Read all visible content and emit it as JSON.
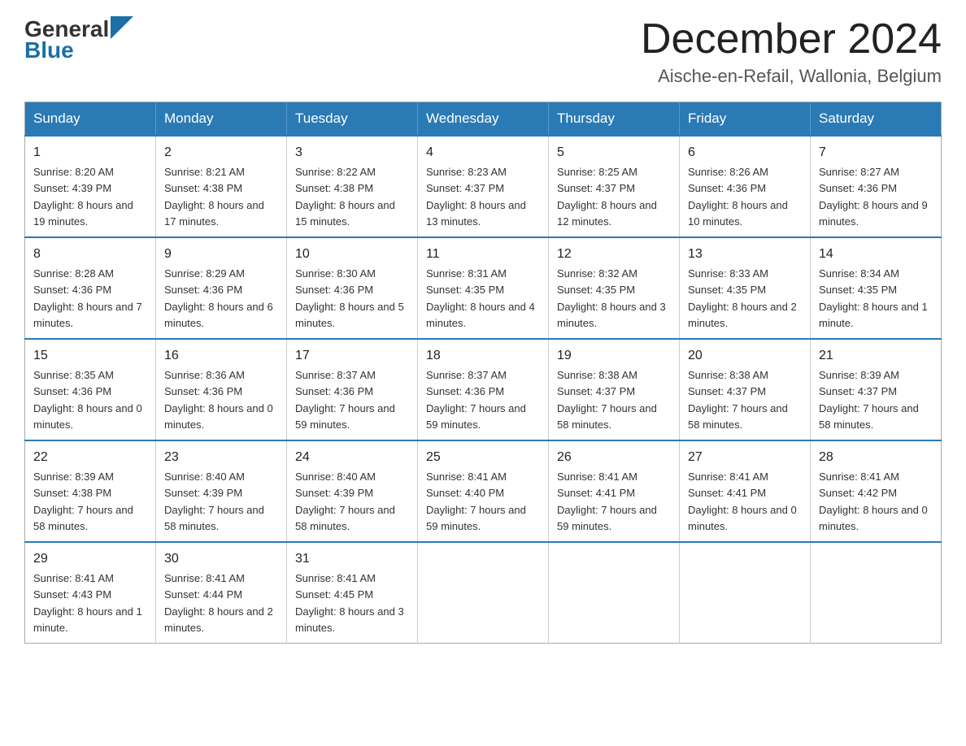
{
  "header": {
    "logo_general": "General",
    "logo_blue": "Blue",
    "title": "December 2024",
    "subtitle": "Aische-en-Refail, Wallonia, Belgium"
  },
  "calendar": {
    "days_of_week": [
      "Sunday",
      "Monday",
      "Tuesday",
      "Wednesday",
      "Thursday",
      "Friday",
      "Saturday"
    ],
    "weeks": [
      [
        {
          "day": "1",
          "sunrise": "8:20 AM",
          "sunset": "4:39 PM",
          "daylight": "8 hours and 19 minutes."
        },
        {
          "day": "2",
          "sunrise": "8:21 AM",
          "sunset": "4:38 PM",
          "daylight": "8 hours and 17 minutes."
        },
        {
          "day": "3",
          "sunrise": "8:22 AM",
          "sunset": "4:38 PM",
          "daylight": "8 hours and 15 minutes."
        },
        {
          "day": "4",
          "sunrise": "8:23 AM",
          "sunset": "4:37 PM",
          "daylight": "8 hours and 13 minutes."
        },
        {
          "day": "5",
          "sunrise": "8:25 AM",
          "sunset": "4:37 PM",
          "daylight": "8 hours and 12 minutes."
        },
        {
          "day": "6",
          "sunrise": "8:26 AM",
          "sunset": "4:36 PM",
          "daylight": "8 hours and 10 minutes."
        },
        {
          "day": "7",
          "sunrise": "8:27 AM",
          "sunset": "4:36 PM",
          "daylight": "8 hours and 9 minutes."
        }
      ],
      [
        {
          "day": "8",
          "sunrise": "8:28 AM",
          "sunset": "4:36 PM",
          "daylight": "8 hours and 7 minutes."
        },
        {
          "day": "9",
          "sunrise": "8:29 AM",
          "sunset": "4:36 PM",
          "daylight": "8 hours and 6 minutes."
        },
        {
          "day": "10",
          "sunrise": "8:30 AM",
          "sunset": "4:36 PM",
          "daylight": "8 hours and 5 minutes."
        },
        {
          "day": "11",
          "sunrise": "8:31 AM",
          "sunset": "4:35 PM",
          "daylight": "8 hours and 4 minutes."
        },
        {
          "day": "12",
          "sunrise": "8:32 AM",
          "sunset": "4:35 PM",
          "daylight": "8 hours and 3 minutes."
        },
        {
          "day": "13",
          "sunrise": "8:33 AM",
          "sunset": "4:35 PM",
          "daylight": "8 hours and 2 minutes."
        },
        {
          "day": "14",
          "sunrise": "8:34 AM",
          "sunset": "4:35 PM",
          "daylight": "8 hours and 1 minute."
        }
      ],
      [
        {
          "day": "15",
          "sunrise": "8:35 AM",
          "sunset": "4:36 PM",
          "daylight": "8 hours and 0 minutes."
        },
        {
          "day": "16",
          "sunrise": "8:36 AM",
          "sunset": "4:36 PM",
          "daylight": "8 hours and 0 minutes."
        },
        {
          "day": "17",
          "sunrise": "8:37 AM",
          "sunset": "4:36 PM",
          "daylight": "7 hours and 59 minutes."
        },
        {
          "day": "18",
          "sunrise": "8:37 AM",
          "sunset": "4:36 PM",
          "daylight": "7 hours and 59 minutes."
        },
        {
          "day": "19",
          "sunrise": "8:38 AM",
          "sunset": "4:37 PM",
          "daylight": "7 hours and 58 minutes."
        },
        {
          "day": "20",
          "sunrise": "8:38 AM",
          "sunset": "4:37 PM",
          "daylight": "7 hours and 58 minutes."
        },
        {
          "day": "21",
          "sunrise": "8:39 AM",
          "sunset": "4:37 PM",
          "daylight": "7 hours and 58 minutes."
        }
      ],
      [
        {
          "day": "22",
          "sunrise": "8:39 AM",
          "sunset": "4:38 PM",
          "daylight": "7 hours and 58 minutes."
        },
        {
          "day": "23",
          "sunrise": "8:40 AM",
          "sunset": "4:39 PM",
          "daylight": "7 hours and 58 minutes."
        },
        {
          "day": "24",
          "sunrise": "8:40 AM",
          "sunset": "4:39 PM",
          "daylight": "7 hours and 58 minutes."
        },
        {
          "day": "25",
          "sunrise": "8:41 AM",
          "sunset": "4:40 PM",
          "daylight": "7 hours and 59 minutes."
        },
        {
          "day": "26",
          "sunrise": "8:41 AM",
          "sunset": "4:41 PM",
          "daylight": "7 hours and 59 minutes."
        },
        {
          "day": "27",
          "sunrise": "8:41 AM",
          "sunset": "4:41 PM",
          "daylight": "8 hours and 0 minutes."
        },
        {
          "day": "28",
          "sunrise": "8:41 AM",
          "sunset": "4:42 PM",
          "daylight": "8 hours and 0 minutes."
        }
      ],
      [
        {
          "day": "29",
          "sunrise": "8:41 AM",
          "sunset": "4:43 PM",
          "daylight": "8 hours and 1 minute."
        },
        {
          "day": "30",
          "sunrise": "8:41 AM",
          "sunset": "4:44 PM",
          "daylight": "8 hours and 2 minutes."
        },
        {
          "day": "31",
          "sunrise": "8:41 AM",
          "sunset": "4:45 PM",
          "daylight": "8 hours and 3 minutes."
        },
        null,
        null,
        null,
        null
      ]
    ],
    "sunrise_label": "Sunrise:",
    "sunset_label": "Sunset:",
    "daylight_label": "Daylight:"
  }
}
